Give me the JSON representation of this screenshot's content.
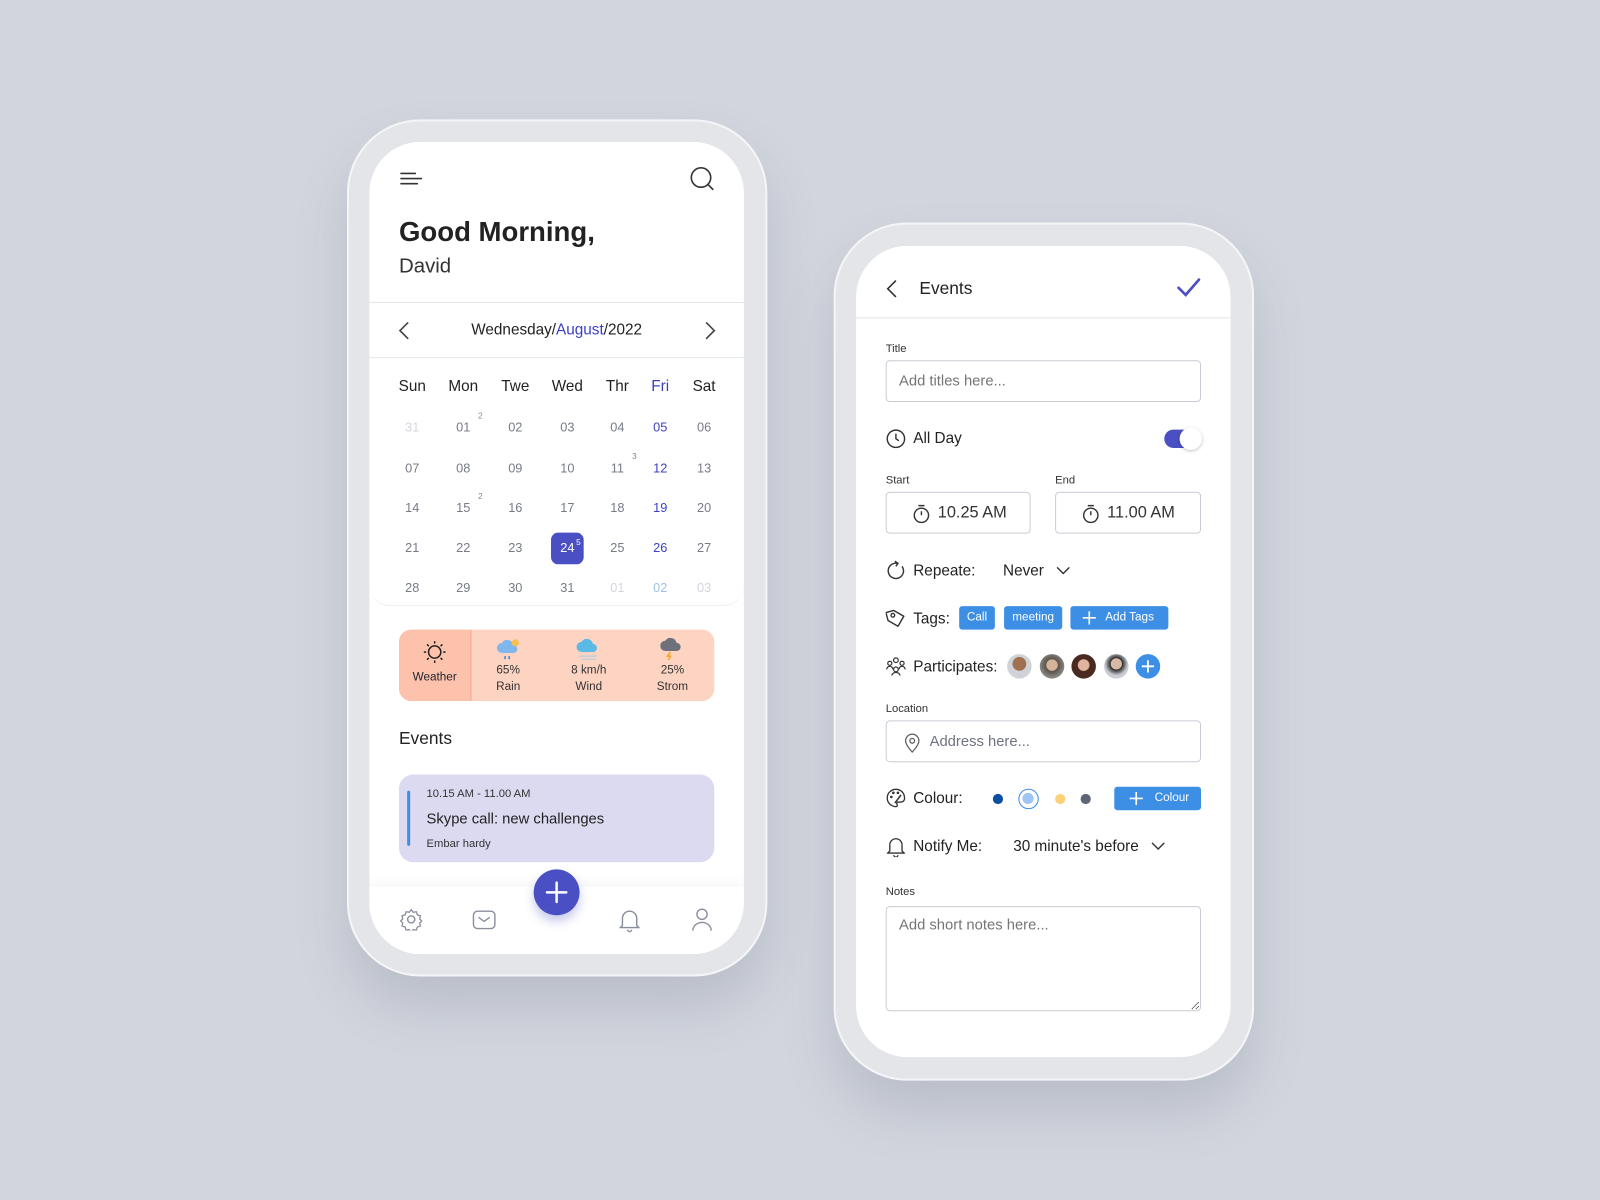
{
  "home": {
    "greeting": "Good Morning,",
    "user_name": "David",
    "date_nav": {
      "weekday": "Wednesday",
      "month": "August",
      "year": "2022",
      "sep": "/"
    },
    "weekdays": [
      "Sun",
      "Mon",
      "Twe",
      "Wed",
      "Thr",
      "Fri",
      "Sat"
    ],
    "weeks": [
      [
        {
          "d": "31",
          "m": 1
        },
        {
          "d": "01",
          "c": "2"
        },
        {
          "d": "02"
        },
        {
          "d": "03"
        },
        {
          "d": "04"
        },
        {
          "d": "05"
        },
        {
          "d": "06"
        }
      ],
      [
        {
          "d": "07"
        },
        {
          "d": "08"
        },
        {
          "d": "09"
        },
        {
          "d": "10"
        },
        {
          "d": "11",
          "c": "3"
        },
        {
          "d": "12"
        },
        {
          "d": "13"
        }
      ],
      [
        {
          "d": "14"
        },
        {
          "d": "15",
          "c": "2"
        },
        {
          "d": "16"
        },
        {
          "d": "17"
        },
        {
          "d": "18"
        },
        {
          "d": "19"
        },
        {
          "d": "20"
        }
      ],
      [
        {
          "d": "21"
        },
        {
          "d": "22"
        },
        {
          "d": "23"
        },
        {
          "d": "24",
          "c": "5",
          "s": 1
        },
        {
          "d": "25"
        },
        {
          "d": "26"
        },
        {
          "d": "27"
        }
      ],
      [
        {
          "d": "28"
        },
        {
          "d": "29"
        },
        {
          "d": "30"
        },
        {
          "d": "31"
        },
        {
          "d": "01",
          "m": 1
        },
        {
          "d": "02",
          "m": 1
        },
        {
          "d": "03",
          "m": 1
        }
      ]
    ],
    "weather": {
      "label": "Weather",
      "items": [
        {
          "value": "65%",
          "label": "Rain"
        },
        {
          "value": "8 km/h",
          "label": "Wind"
        },
        {
          "value": "25%",
          "label": "Strom"
        }
      ]
    },
    "events_heading": "Events",
    "event": {
      "time": "10.15 AM - 11.00 AM",
      "title": "Skype call: new challenges",
      "person": "Embar hardy"
    },
    "nav": [
      "settings-icon",
      "mail-icon",
      "add-icon",
      "bell-icon",
      "profile-icon"
    ]
  },
  "editor": {
    "title": "Events",
    "title_label": "Title",
    "title_placeholder": "Add titles here...",
    "all_day_label": "All Day",
    "all_day": true,
    "start_label": "Start",
    "start_value": "10.25 AM",
    "end_label": "End",
    "end_value": "11.00 AM",
    "repeat_label": "Repeate:",
    "repeat_value": "Never",
    "tags_label": "Tags:",
    "tags": [
      "Call",
      "meeting"
    ],
    "add_tags": "Add Tags",
    "participants_label": "Participates:",
    "location_label": "Location",
    "location_placeholder": "Address here...",
    "colour_label": "Colour:",
    "colours": [
      "#0a4fa3",
      "#9fc6f2",
      "#fdd17a",
      "#5d6677"
    ],
    "selected_colour": "#9fc6f2",
    "add_colour": "Colour",
    "notify_label": "Notify Me:",
    "notify_value": "30 minute's before",
    "notes_label": "Notes",
    "notes_placeholder": "Add short notes here..."
  },
  "colors": {
    "accent": "#4a4fc4",
    "blue": "#3d8fe6",
    "weather_bg": "#fdd3c2",
    "event_bg": "#dcdaf1"
  }
}
